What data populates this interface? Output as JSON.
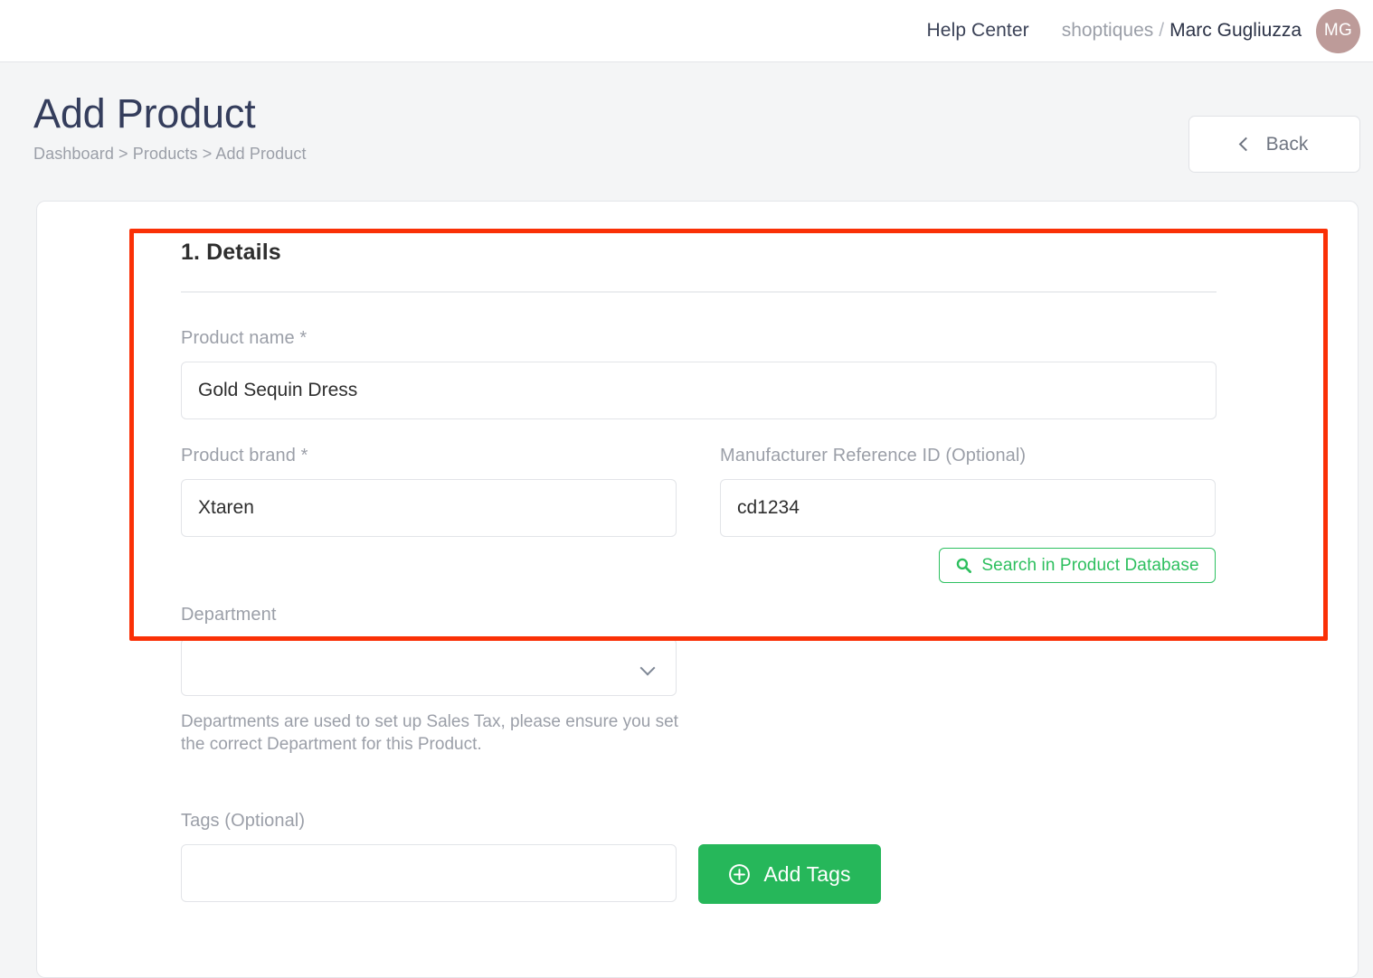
{
  "topbar": {
    "help_center": "Help Center",
    "org": "shoptiques",
    "separator": "/",
    "user": "Marc Gugliuzza",
    "avatar_initials": "MG"
  },
  "header": {
    "title": "Add Product",
    "breadcrumb": "Dashboard > Products > Add Product",
    "back_label": "Back"
  },
  "form": {
    "section_title": "1. Details",
    "product_name": {
      "label": "Product name *",
      "value": "Gold Sequin Dress",
      "placeholder": ""
    },
    "product_brand": {
      "label": "Product brand *",
      "value": "Xtaren",
      "placeholder": ""
    },
    "manufacturer_ref": {
      "label": "Manufacturer Reference ID (Optional)",
      "value": "cd1234",
      "placeholder": ""
    },
    "search_database_label": "Search in Product Database",
    "department": {
      "label": "Department",
      "value": "",
      "help": "Departments are used to set up Sales Tax, please ensure you set the correct Department for this Product."
    },
    "tags": {
      "label": "Tags (Optional)",
      "value": "",
      "placeholder": "",
      "add_button_label": "Add Tags"
    }
  },
  "colors": {
    "accent_green": "#26b75a",
    "outline_green": "#2dc060",
    "highlight_red": "#fa3006",
    "title_navy": "#343d5c",
    "avatar_bg": "#bd9b99",
    "page_bg": "#f4f5f6"
  }
}
